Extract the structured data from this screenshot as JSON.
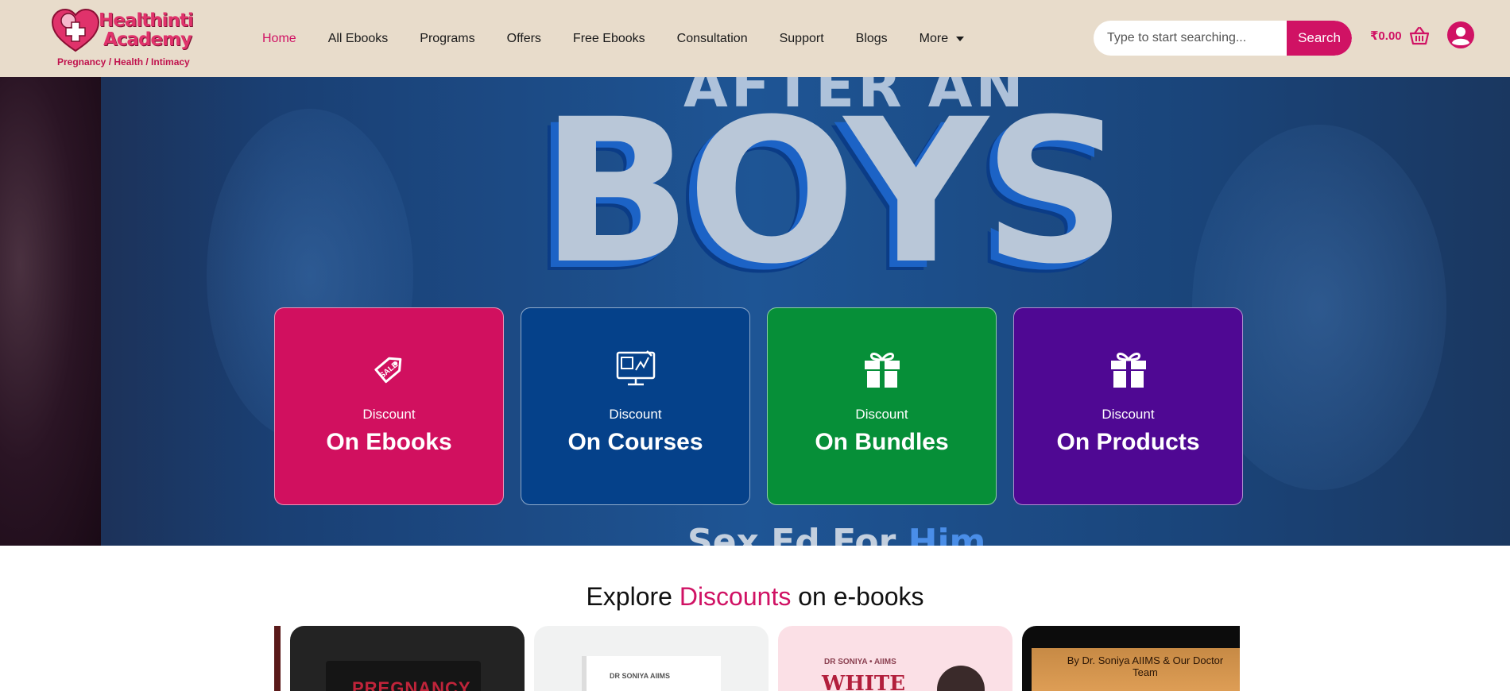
{
  "brand": {
    "title_line1": "Healthinti",
    "title_line2": "Academy",
    "tagline": "Pregnancy / Health / Intimacy",
    "accent_color": "#d01264",
    "header_bg": "#e8dccb"
  },
  "nav": {
    "items": [
      {
        "label": "Home",
        "active": true
      },
      {
        "label": "All Ebooks"
      },
      {
        "label": "Programs"
      },
      {
        "label": "Offers"
      },
      {
        "label": "Free Ebooks"
      },
      {
        "label": "Consultation"
      },
      {
        "label": "Support"
      },
      {
        "label": "Blogs"
      },
      {
        "label": "More"
      }
    ]
  },
  "search": {
    "placeholder": "Type to start searching...",
    "button_label": "Search"
  },
  "cart": {
    "total": "₹0.00",
    "icon": "basket-icon"
  },
  "account": {
    "icon": "user-icon"
  },
  "hero": {
    "headline": "BOYS",
    "top_text": "AFTER AN",
    "bottom_text_prefix": "Sex Ed For ",
    "bottom_text_highlight": "Him"
  },
  "cards": [
    {
      "small": "Discount",
      "big": "On Ebooks",
      "color": "#d1105f",
      "icon": "sale-tag-icon"
    },
    {
      "small": "Discount",
      "big": "On Courses",
      "color": "#05418a",
      "icon": "monitor-course-icon"
    },
    {
      "small": "Discount",
      "big": "On Bundles",
      "color": "#068f38",
      "icon": "gift-icon"
    },
    {
      "small": "Discount",
      "big": "On Products",
      "color": "#4f0893",
      "icon": "gift-icon"
    }
  ],
  "section": {
    "title_prefix": "Explore ",
    "title_accent": "Discounts",
    "title_suffix": " on e-books"
  },
  "books": [
    {
      "cover_text": "PREGNANCY"
    },
    {
      "cover_text": "DR SONIYA AIIMS"
    },
    {
      "author": "DR SONIYA • AIIMS",
      "cover_text": "WHITE"
    },
    {
      "cover_text": "By Dr. Soniya AIIMS & Our Doctor Team"
    }
  ]
}
